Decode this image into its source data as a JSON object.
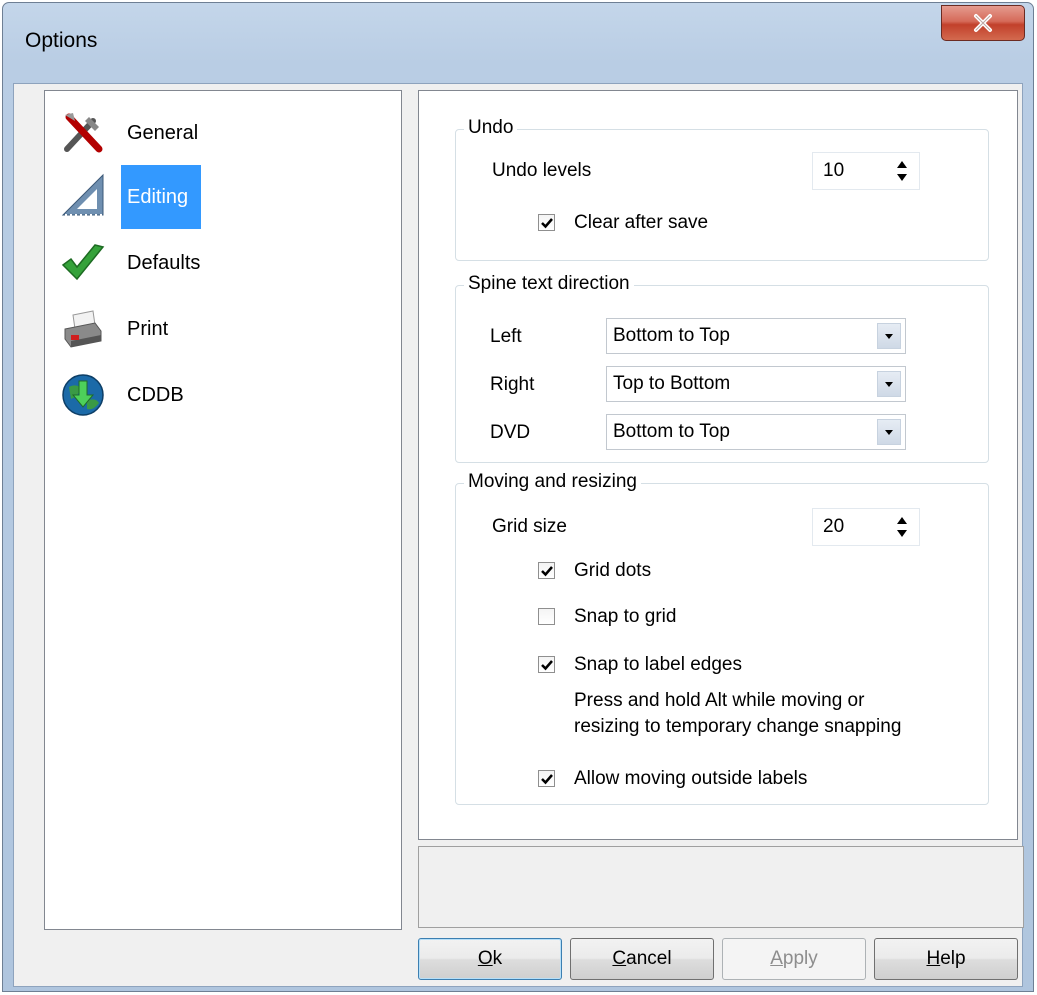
{
  "window": {
    "title": "Options",
    "close_label": "X"
  },
  "nav": {
    "items": [
      {
        "label": "General",
        "icon": "tools-icon"
      },
      {
        "label": "Editing",
        "icon": "set-square-icon",
        "selected": true
      },
      {
        "label": "Defaults",
        "icon": "checkmark-icon"
      },
      {
        "label": "Print",
        "icon": "printer-icon"
      },
      {
        "label": "CDDB",
        "icon": "globe-download-icon"
      }
    ]
  },
  "undo": {
    "title": "Undo",
    "levels_label": "Undo levels",
    "levels_value": "10",
    "clear_after_save_label": "Clear after save",
    "clear_after_save_checked": true
  },
  "spine": {
    "title": "Spine text direction",
    "rows": [
      {
        "label": "Left",
        "value": "Bottom to Top"
      },
      {
        "label": "Right",
        "value": "Top to Bottom"
      },
      {
        "label": "DVD",
        "value": "Bottom to Top"
      }
    ]
  },
  "moving": {
    "title": "Moving and resizing",
    "grid_size_label": "Grid size",
    "grid_size_value": "20",
    "grid_dots_label": "Grid dots",
    "grid_dots_checked": true,
    "snap_grid_label": "Snap to grid",
    "snap_grid_checked": false,
    "snap_edges_label": "Snap to label edges",
    "snap_edges_checked": true,
    "hint_line1": "Press and hold Alt while moving or",
    "hint_line2": "resizing to temporary change snapping",
    "allow_outside_label": "Allow moving outside labels",
    "allow_outside_checked": true
  },
  "buttons": {
    "ok_first": "O",
    "ok_rest": "k",
    "cancel_first": "C",
    "cancel_rest": "ancel",
    "apply_first": "A",
    "apply_rest": "pply",
    "help_first": "H",
    "help_rest": "elp"
  }
}
